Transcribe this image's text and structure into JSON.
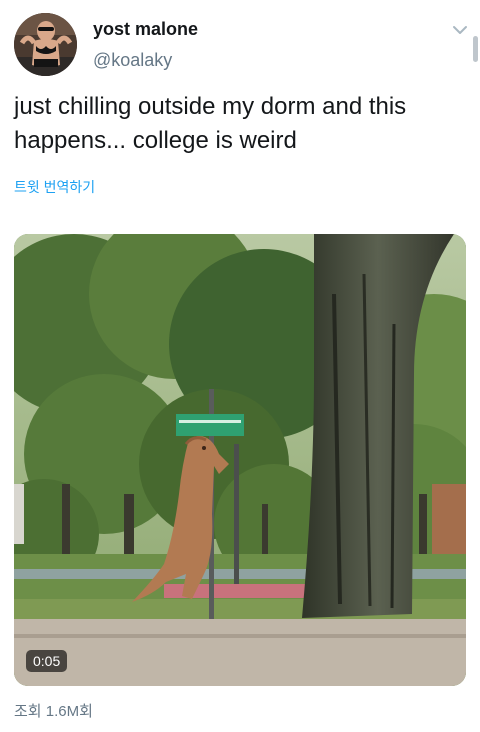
{
  "tweet": {
    "display_name": "yost malone",
    "handle": "@koalaky",
    "text": "just chilling outside my dorm and this happens... college is weird",
    "translate_label": "트윗 번역하기",
    "menu_icon": "chevron-down-icon",
    "video_duration": "0:05",
    "views_label": "조회 1.6M회"
  },
  "colors": {
    "link": "#1da1f2",
    "secondary_text": "#657786",
    "primary_text": "#14171a"
  }
}
